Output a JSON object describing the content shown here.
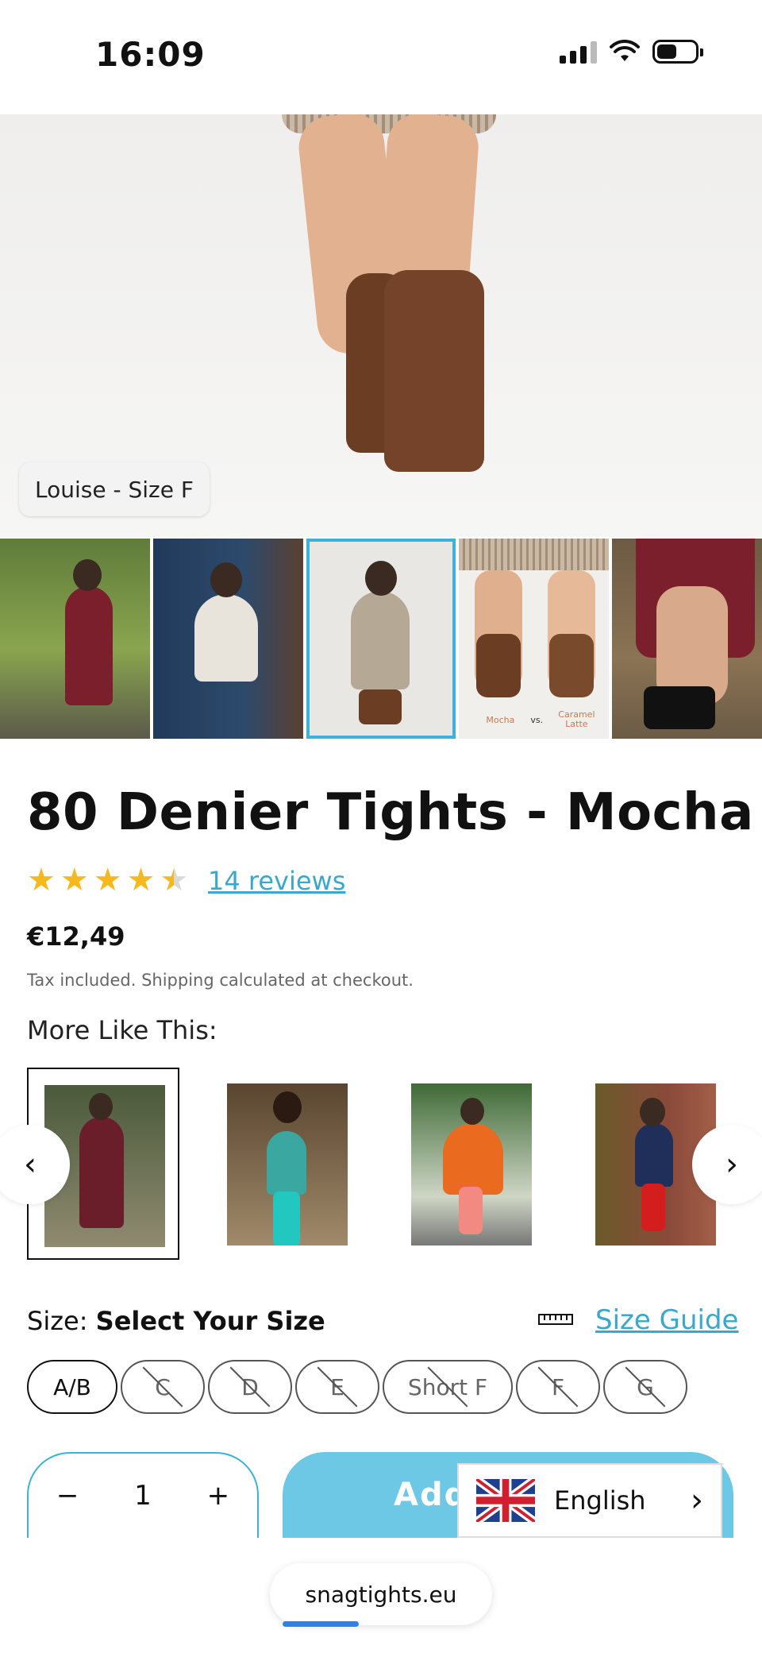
{
  "status": {
    "time": "16:09"
  },
  "hero": {
    "caption": "Louise - Size F"
  },
  "thumbnails": [
    {
      "label_left": "",
      "label_right": ""
    },
    {
      "label_left": "",
      "label_right": ""
    },
    {
      "label_left": "",
      "label_right": ""
    },
    {
      "label_left": "Mocha",
      "label_mid": "vs.",
      "label_right": "Caramel Latte"
    },
    {
      "label_left": "",
      "label_right": ""
    }
  ],
  "product": {
    "title": "80 Denier Tights - Mocha",
    "rating": 4.5,
    "reviews_label": "14 reviews",
    "price": "€12,49",
    "tax_note": "Tax included. Shipping calculated at checkout."
  },
  "more_like_this": {
    "heading": "More Like This:"
  },
  "size": {
    "label": "Size:",
    "selected_text": "Select Your Size",
    "guide_label": "Size Guide",
    "options": [
      "A/B",
      "C",
      "D",
      "E",
      "Short F",
      "F",
      "G"
    ]
  },
  "cart": {
    "quantity": "1",
    "add_label": "Add",
    "minus": "−",
    "plus": "+"
  },
  "language": {
    "label": "English"
  },
  "browser": {
    "url": "snagtights.eu"
  },
  "colors": {
    "accent": "#3cb2d6",
    "star": "#f5b81d",
    "link": "#3aa7cc",
    "button": "#6cc8e4"
  }
}
